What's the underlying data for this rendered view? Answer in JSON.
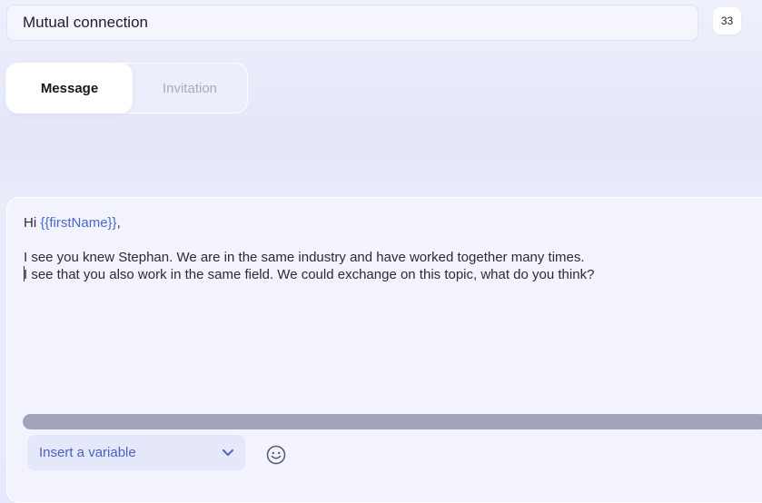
{
  "header": {
    "name_value": "Mutual connection",
    "count": "33"
  },
  "tabs": [
    {
      "label": "Message",
      "active": true
    },
    {
      "label": "Invitation",
      "active": false
    }
  ],
  "message": {
    "greeting_prefix": "Hi ",
    "greeting_variable": "{{firstName}}",
    "greeting_suffix": ",",
    "line1": "I see you knew Stephan. We are in the same industry and have worked together many times.",
    "line2": "I see that you also work in the same field. We could exchange on this topic, what do you think?"
  },
  "toolbar": {
    "insert_variable_label": "Insert a variable",
    "insert_variable_icon": "chevron-down-icon",
    "emoji_icon": "smiley-icon"
  },
  "colors": {
    "variable": "#4a67c8",
    "scrollbar": "#a3a4bc",
    "accent_text": "#4b62c0"
  }
}
